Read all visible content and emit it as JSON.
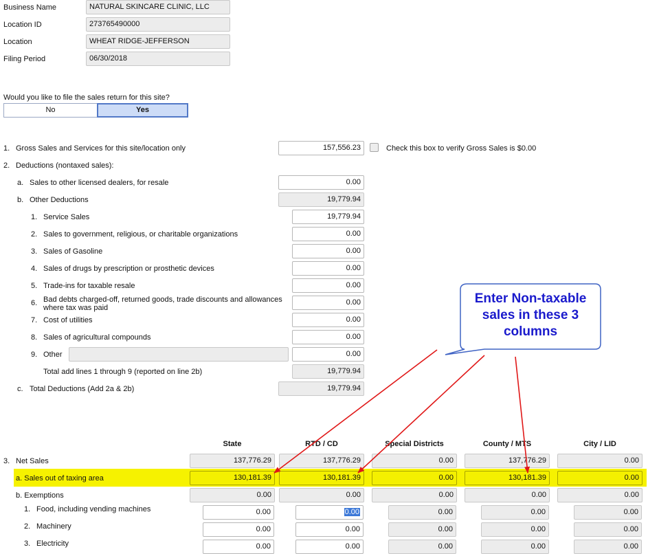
{
  "business": {
    "name_label": "Business Name",
    "name_value": "NATURAL SKINCARE CLINIC, LLC",
    "location_id_label": "Location ID",
    "location_id_value": "273765490000",
    "location_label": "Location",
    "location_value": "WHEAT RIDGE-JEFFERSON",
    "period_label": "Filing Period",
    "period_value": "06/30/2018"
  },
  "file_question": {
    "prompt": "Would you like to file the sales return for this site?",
    "no_label": "No",
    "yes_label": "Yes",
    "selected": "Yes"
  },
  "line1": {
    "num": "1.",
    "label": "Gross Sales and Services for this site/location only",
    "value": "157,556.23",
    "checkbox_label": "Check this box to verify Gross Sales is $0.00"
  },
  "line2": {
    "num": "2.",
    "label": "Deductions (nontaxed sales):",
    "a_num": "a.",
    "a_label": "Sales to other licensed dealers, for resale",
    "a_value": "0.00",
    "b_num": "b.",
    "b_label": "Other Deductions",
    "b_value": "19,779.94",
    "items": [
      {
        "num": "1.",
        "label": "Service Sales",
        "value": "19,779.94"
      },
      {
        "num": "2.",
        "label": "Sales to government, religious, or charitable organizations",
        "value": "0.00"
      },
      {
        "num": "3.",
        "label": "Sales of Gasoline",
        "value": "0.00"
      },
      {
        "num": "4.",
        "label": "Sales of drugs by prescription or prosthetic devices",
        "value": "0.00"
      },
      {
        "num": "5.",
        "label": "Trade-ins for taxable resale",
        "value": "0.00"
      },
      {
        "num": "6.",
        "label": "Bad debts charged-off, returned goods, trade discounts and allowances",
        "label2": "where tax was paid",
        "value": "0.00"
      },
      {
        "num": "7.",
        "label": "Cost of utilities",
        "value": "0.00"
      },
      {
        "num": "8.",
        "label": "Sales of agricultural compounds",
        "value": "0.00"
      },
      {
        "num": "9.",
        "label": "Other",
        "value": "0.00",
        "other_text": ""
      }
    ],
    "total_label": "Total add lines 1 through 9 (reported on line 2b)",
    "total_value": "19,779.94",
    "c_num": "c.",
    "c_label": "Total Deductions (Add 2a & 2b)",
    "c_value": "19,779.94"
  },
  "columns": [
    "State",
    "RTD / CD",
    "Special Districts",
    "County / MTS",
    "City / LID"
  ],
  "line3": {
    "num": "3.",
    "net_label": "Net Sales",
    "net_values": [
      "137,776.29",
      "137,776.29",
      "0.00",
      "137,776.29",
      "0.00"
    ],
    "out_label": "a. Sales out of taxing area",
    "out_values": [
      "130,181.39",
      "130,181.39",
      "0.00",
      "130,181.39",
      "0.00"
    ],
    "exempt_label": "b. Exemptions",
    "exempt_values": [
      "0.00",
      "0.00",
      "0.00",
      "0.00",
      "0.00"
    ],
    "food_num": "1.",
    "food_label": "Food, including vending machines",
    "food_values": [
      "0.00",
      "0.00",
      "0.00",
      "0.00",
      "0.00"
    ],
    "mach_num": "2.",
    "mach_label": "Machinery",
    "mach_values": [
      "0.00",
      "0.00",
      "0.00",
      "0.00",
      "0.00"
    ],
    "elec_num": "3.",
    "elec_label": "Electricity",
    "elec_values": [
      "0.00",
      "0.00",
      "0.00",
      "0.00",
      "0.00"
    ]
  },
  "callout": {
    "text_line1": "Enter Non-taxable",
    "text_line2": "sales in these 3",
    "text_line3": "columns",
    "text_color": "#1a1acc",
    "border_color": "#3f63c4",
    "arrow_color": "#e01818"
  },
  "highlight_color": "#f6f200"
}
